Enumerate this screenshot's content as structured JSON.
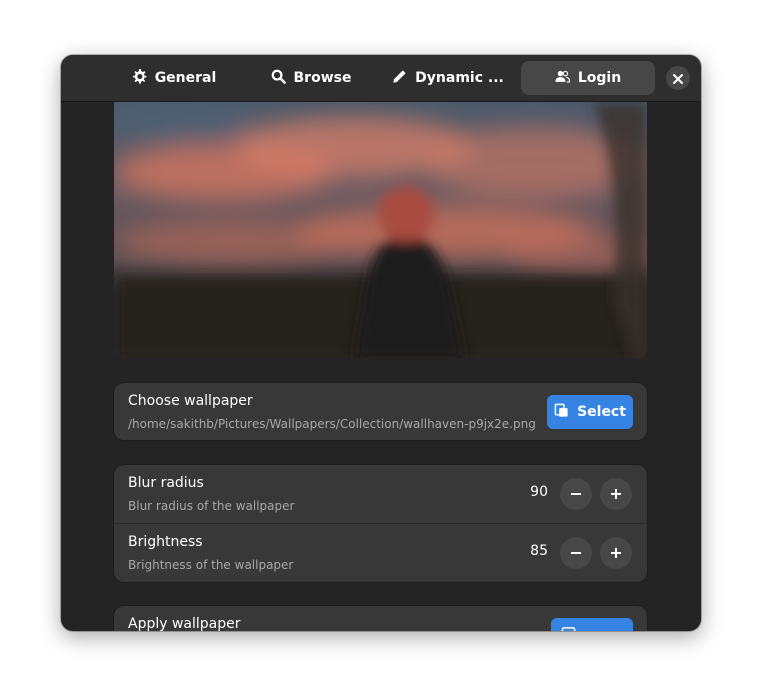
{
  "tabs": [
    {
      "label": "General",
      "icon": "gear-icon"
    },
    {
      "label": "Browse",
      "icon": "search-icon"
    },
    {
      "label": "Dynamic ...",
      "icon": "pencil-icon"
    },
    {
      "label": "Login",
      "icon": "users-icon",
      "active": true
    }
  ],
  "close_icon": "close-icon",
  "choose": {
    "title": "Choose wallpaper",
    "path": "/home/sakithb/Pictures/Wallpapers/Collection/wallhaven-p9jx2e.png",
    "button": "Select"
  },
  "blur": {
    "title": "Blur radius",
    "subtitle": "Blur radius of the wallpaper",
    "value": "90"
  },
  "brightness": {
    "title": "Brightness",
    "subtitle": "Brightness of the wallpaper",
    "value": "85"
  },
  "apply": {
    "title": "Apply wallpaper"
  },
  "colors": {
    "accent": "#3584e4",
    "window_bg": "#242424",
    "card_bg": "#383838",
    "headerbar": "#2e2e2e"
  }
}
